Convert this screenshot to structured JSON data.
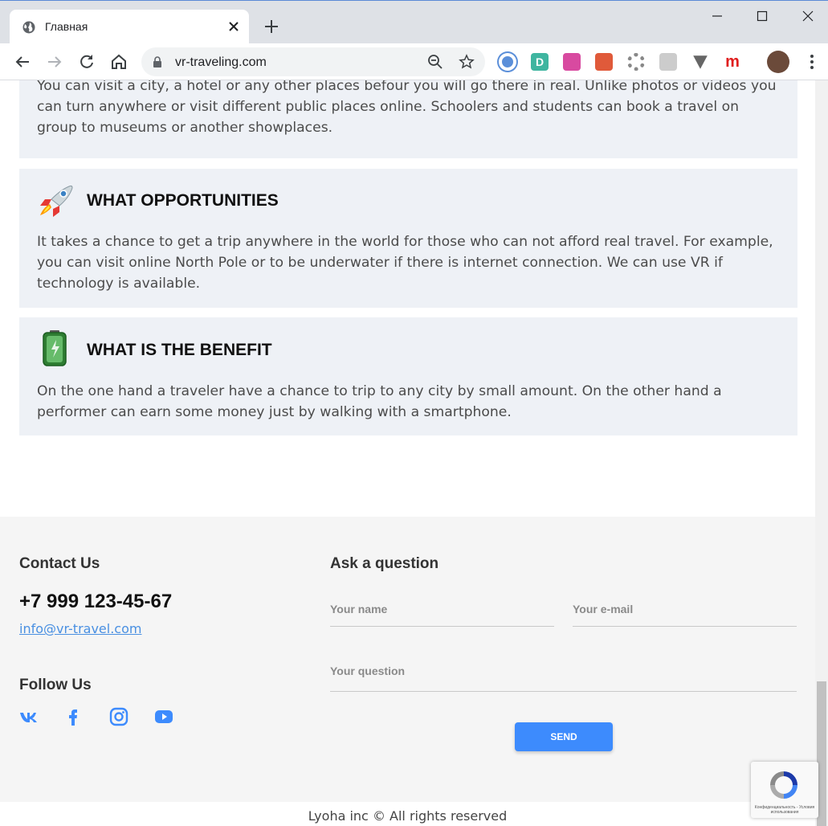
{
  "browser": {
    "tab_title": "Главная",
    "url": "vr-traveling.com",
    "extensions": [
      {
        "name": "extension-1-icon",
        "color": "#5b8fd9"
      },
      {
        "name": "extension-d-icon",
        "color": "#3fb5a0",
        "label": "D"
      },
      {
        "name": "extension-3-icon",
        "color": "#d84aa0"
      },
      {
        "name": "extension-4-icon",
        "color": "#e05a3a"
      },
      {
        "name": "extension-gear-icon",
        "color": "#888888"
      },
      {
        "name": "extension-6-icon",
        "color": "#cccccc"
      },
      {
        "name": "extension-v-icon",
        "color": "#666666"
      },
      {
        "name": "extension-m-icon",
        "color": "#e01e1e",
        "label": "m"
      }
    ]
  },
  "cards": [
    {
      "text": "You can visit a city, a hotel or any other places befour you will go there in real. Unlike photos or videos you can turn anywhere or visit different public places online. Schoolers and students can book a travel on group to museums or another showplaces."
    },
    {
      "heading": "WHAT OPPORTUNITIES",
      "icon": "rocket-icon",
      "text": "It takes a chance to get a trip anywhere in the world for those who can not afford real travel. For example, you can visit online North Pole or to be underwater if there is internet connection. We can use VR if technology is available."
    },
    {
      "heading": "WHAT IS THE BENEFIT",
      "icon": "battery-icon",
      "text": "On the one hand a traveler have a chance to trip to any city by small amount. On the other hand a performer can earn some money just by walking with a smartphone."
    }
  ],
  "footer": {
    "contact_heading": "Contact Us",
    "phone": "+7 999 123-45-67",
    "email": "info@vr-travel.com",
    "follow_heading": "Follow Us",
    "social": [
      "vk-icon",
      "facebook-icon",
      "instagram-icon",
      "youtube-icon"
    ],
    "ask_heading": "Ask a question",
    "name_placeholder": "Your name",
    "email_placeholder": "Your e-mail",
    "question_placeholder": "Your question",
    "send_label": "SEND",
    "copyright": "Lyoha inc © All rights reserved",
    "recaptcha_text": "Конфиденциальность - Условия использования"
  },
  "colors": {
    "accent": "#3d8bfd",
    "link": "#4a90e2",
    "card_bg": "#eef1f6",
    "footer_bg": "#f5f5f5"
  }
}
